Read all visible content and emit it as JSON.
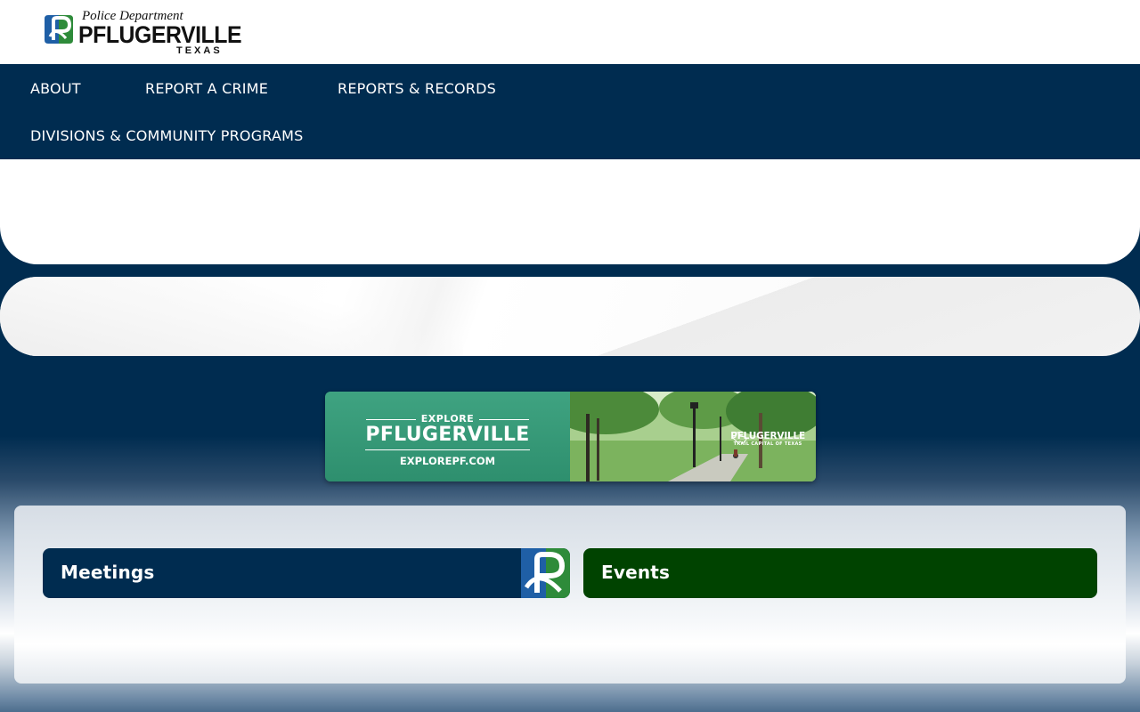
{
  "header": {
    "logo": {
      "top_text": "Police Department",
      "main_text": "PFLUGERVILLE",
      "sub_text": "TEXAS"
    }
  },
  "nav": {
    "items": [
      {
        "label": "ABOUT"
      },
      {
        "label": "REPORT A CRIME"
      },
      {
        "label": "REPORTS & RECORDS"
      },
      {
        "label": "DIVISIONS & COMMUNITY PROGRAMS"
      }
    ]
  },
  "banner": {
    "explore": "EXPLORE",
    "title": "PFLUGERVILLE",
    "url": "EXPLOREPF.COM",
    "brand_main": "PFLUGERVILLE",
    "brand_sub": "TRAIL CAPITAL OF TEXAS"
  },
  "cards": [
    {
      "label": "Meetings",
      "color": "#002c50"
    },
    {
      "label": "Events",
      "color": "#004300"
    }
  ],
  "colors": {
    "navy": "#002c50",
    "green": "#004300",
    "logo_blue": "#1f5fa6",
    "logo_green": "#2e8b3a"
  }
}
